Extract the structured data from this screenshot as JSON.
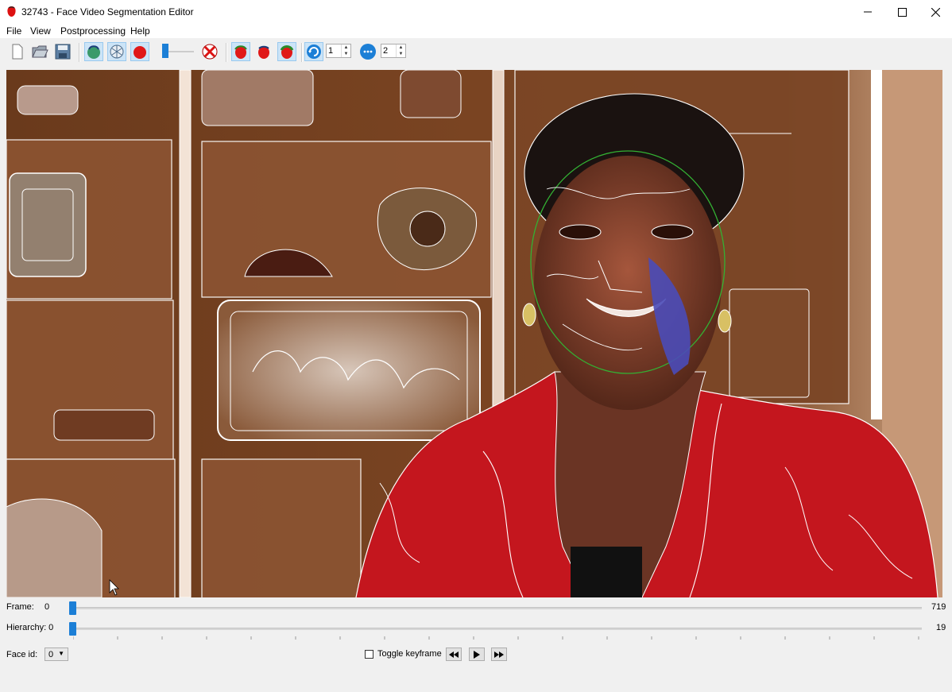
{
  "window": {
    "title": "32743 - Face Video Segmentation Editor",
    "icons": [
      "app-face-icon",
      "minimize-icon",
      "maximize-icon",
      "close-icon"
    ]
  },
  "menu": {
    "file": "File",
    "view": "View",
    "postprocessing": "Postprocessing",
    "help": "Help"
  },
  "toolbar": {
    "buttons": [
      "new-file-icon",
      "open-folder-icon",
      "save-icon",
      "contours-icon",
      "segmentation-icon",
      "face-fill-icon",
      "opacity-slider",
      "clear-icon",
      "face-mode-a-icon",
      "face-mode-b-icon",
      "face-mode-c-icon",
      "refresh-icon",
      "brush-size-icon"
    ],
    "spin1_value": "1",
    "spin2_value": "2",
    "accent": "#1c7fd6"
  },
  "controls": {
    "frame_label": "Frame:",
    "frame_value": "0",
    "frame_max": "719",
    "hierarchy_label": "Hierarchy: 0",
    "hierarchy_max": "19",
    "face_id_label": "Face id:",
    "face_id_value": "0",
    "toggle_keyframe": "Toggle keyframe"
  }
}
